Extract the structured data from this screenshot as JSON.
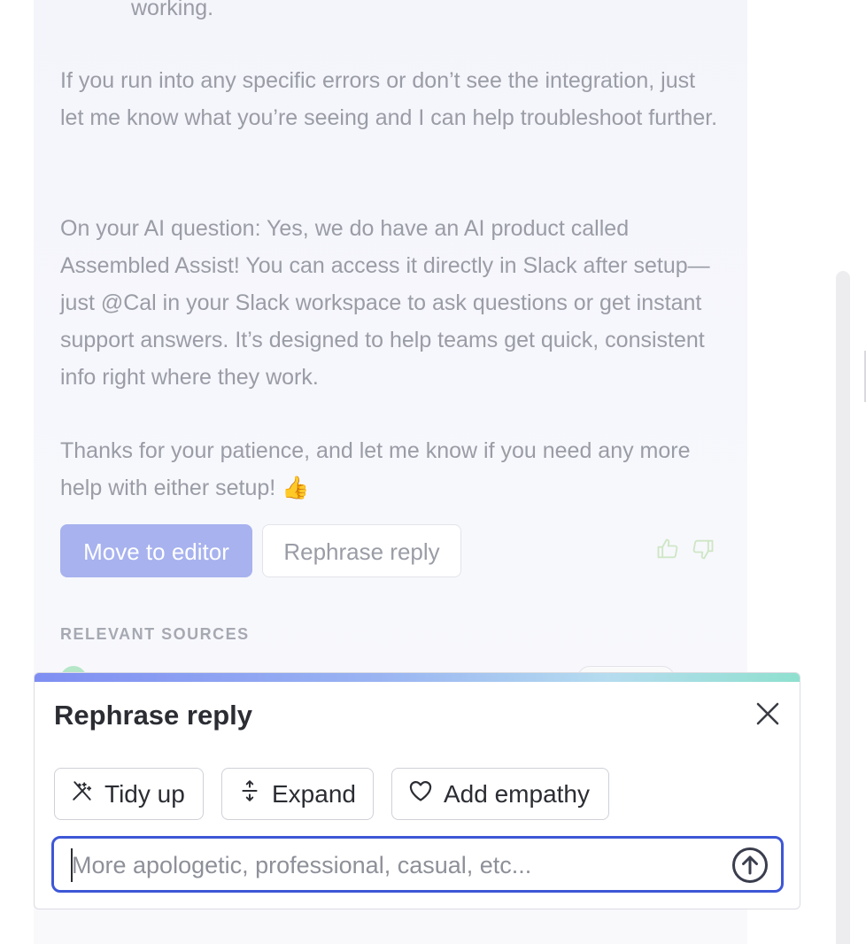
{
  "reply": {
    "fragment_top": "working.",
    "paragraph_1": "If you run into any specific errors or don’t see the integration, just let me know what you’re seeing and I can help troubleshoot further.",
    "paragraph_2": "On your AI question: Yes, we do have an AI product called Assembled Assist! You can access it directly in Slack after setup—just @Cal in your Slack workspace to ask questions or get instant support answers. It’s designed to help teams get quick, consistent info right where they work.",
    "paragraph_3": "Thanks for your patience, and let me know if you need any more help with either setup! 👍",
    "move_to_editor_label": "Move to editor",
    "rephrase_reply_label": "Rephrase reply",
    "feedback_icons": [
      "thumbs-up-icon",
      "thumbs-down-icon"
    ]
  },
  "sources": {
    "label": "RELEVANT SOURCES"
  },
  "rephrase_panel": {
    "title": "Rephrase reply",
    "close_icon": "close-icon",
    "options": [
      {
        "label": "Tidy up",
        "icon": "magic-wand-icon"
      },
      {
        "label": "Expand",
        "icon": "expand-vertical-icon"
      },
      {
        "label": "Add empathy",
        "icon": "heart-icon"
      }
    ],
    "input": {
      "value": "",
      "placeholder": "More apologetic, professional, casual, etc..."
    },
    "send_icon": "send-arrow-up-icon"
  },
  "colors": {
    "accent": "#3e57d6",
    "primary_button_faded": "#a7b2ee",
    "strip_start": "#7f8ef2",
    "strip_end": "#8fe0cf"
  }
}
